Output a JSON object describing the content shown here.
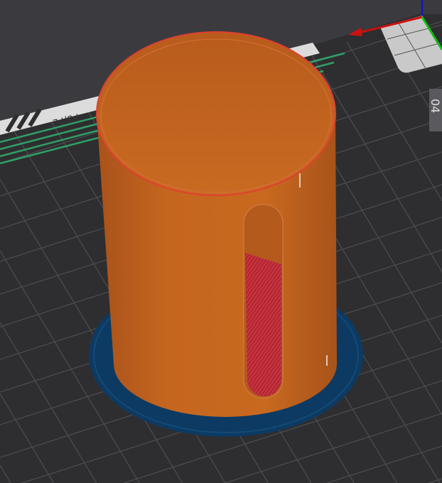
{
  "viewport": {
    "bed_label": "PU/PL",
    "bed_corner_label": "04"
  },
  "colors": {
    "background": "#3b3b3f",
    "bed": "#2e2e30",
    "grid": "#4a4a4e",
    "perimeter": "#c0601e",
    "brim": "#0c3a63",
    "infill": "#c0303a",
    "axis_x": "#d01010",
    "axis_y": "#10c010",
    "axis_z": "#1010c0"
  }
}
